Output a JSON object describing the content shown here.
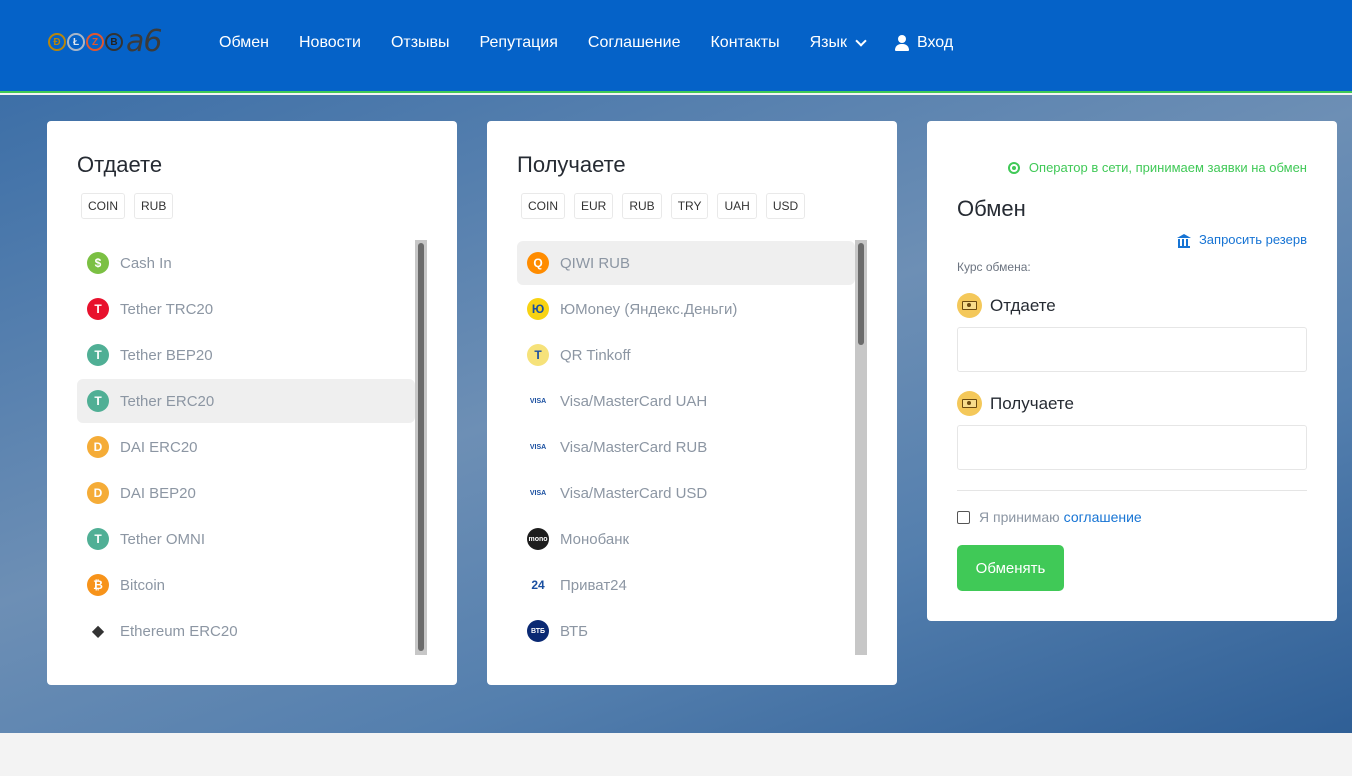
{
  "header": {
    "logo_text": "a6",
    "logo_coins": [
      "Ð",
      "Ł",
      "Z",
      "B"
    ],
    "nav": [
      {
        "label": "Обмен"
      },
      {
        "label": "Новости"
      },
      {
        "label": "Отзывы"
      },
      {
        "label": "Репутация"
      },
      {
        "label": "Соглашение"
      },
      {
        "label": "Контакты"
      },
      {
        "label": "Язык"
      },
      {
        "label": "Вход"
      }
    ]
  },
  "give": {
    "title": "Отдаете",
    "tags": [
      "COIN",
      "RUB"
    ],
    "items": [
      {
        "label": "Cash In",
        "icon": "cash-in-icon",
        "color": "#7bc043",
        "glyph": "$",
        "active": false
      },
      {
        "label": "Tether TRC20",
        "icon": "tether-trc20-icon",
        "color": "#e8112d",
        "glyph": "T",
        "active": false
      },
      {
        "label": "Tether BEP20",
        "icon": "tether-bep20-icon",
        "color": "#50af95",
        "glyph": "T",
        "active": false
      },
      {
        "label": "Tether ERC20",
        "icon": "tether-erc20-icon",
        "color": "#50af95",
        "glyph": "T",
        "active": true
      },
      {
        "label": "DAI ERC20",
        "icon": "dai-erc20-icon",
        "color": "#f5ac37",
        "glyph": "D",
        "active": false
      },
      {
        "label": "DAI BEP20",
        "icon": "dai-bep20-icon",
        "color": "#f5ac37",
        "glyph": "D",
        "active": false
      },
      {
        "label": "Tether OMNI",
        "icon": "tether-omni-icon",
        "color": "#50af95",
        "glyph": "T",
        "active": false
      },
      {
        "label": "Bitcoin",
        "icon": "bitcoin-icon",
        "color": "#f7931a",
        "glyph": "₿",
        "active": false
      },
      {
        "label": "Ethereum ERC20",
        "icon": "ethereum-icon",
        "color": "#ffffff",
        "glyph": "◆",
        "active": false
      }
    ]
  },
  "receive": {
    "title": "Получаете",
    "tags": [
      "COIN",
      "EUR",
      "RUB",
      "TRY",
      "UAH",
      "USD"
    ],
    "items": [
      {
        "label": "QIWI RUB",
        "icon": "qiwi-icon",
        "color": "#ff8c00",
        "glyph": "Q",
        "active": true
      },
      {
        "label": "ЮMoney (Яндекс.Деньги)",
        "icon": "yoomoney-icon",
        "color": "#f8d313",
        "glyph": "Ю",
        "active": false
      },
      {
        "label": "QR Tinkoff",
        "icon": "tinkoff-icon",
        "color": "#f6e27a",
        "glyph": "T",
        "active": false
      },
      {
        "label": "Visa/MasterCard UAH",
        "icon": "visa-mastercard-icon",
        "color": "#ffffff",
        "glyph": "VISA",
        "active": false
      },
      {
        "label": "Visa/MasterCard RUB",
        "icon": "visa-mastercard-icon",
        "color": "#ffffff",
        "glyph": "VISA",
        "active": false
      },
      {
        "label": "Visa/MasterCard USD",
        "icon": "visa-mastercard-icon",
        "color": "#ffffff",
        "glyph": "VISA",
        "active": false
      },
      {
        "label": "Монобанк",
        "icon": "monobank-icon",
        "color": "#1d1d1d",
        "glyph": "mono",
        "active": false
      },
      {
        "label": "Приват24",
        "icon": "privat24-icon",
        "color": "#ffffff",
        "glyph": "24",
        "active": false
      },
      {
        "label": "ВТБ",
        "icon": "vtb-icon",
        "color": "#0a2973",
        "glyph": "ВТБ",
        "active": false
      }
    ]
  },
  "exchange": {
    "status": "Оператор в сети, принимаем заявки на обмен",
    "title": "Обмен",
    "reserve_link": "Запросить резерв",
    "rate_label": "Курс обмена:",
    "give_label": "Отдаете",
    "give_value": "",
    "receive_label": "Получаете",
    "receive_value": "",
    "agree_text": "Я принимаю",
    "agree_link": "соглашение",
    "submit": "Обменять"
  },
  "colors": {
    "header": "#0562c8",
    "accent_green": "#40c957",
    "link_blue": "#1774d4"
  }
}
